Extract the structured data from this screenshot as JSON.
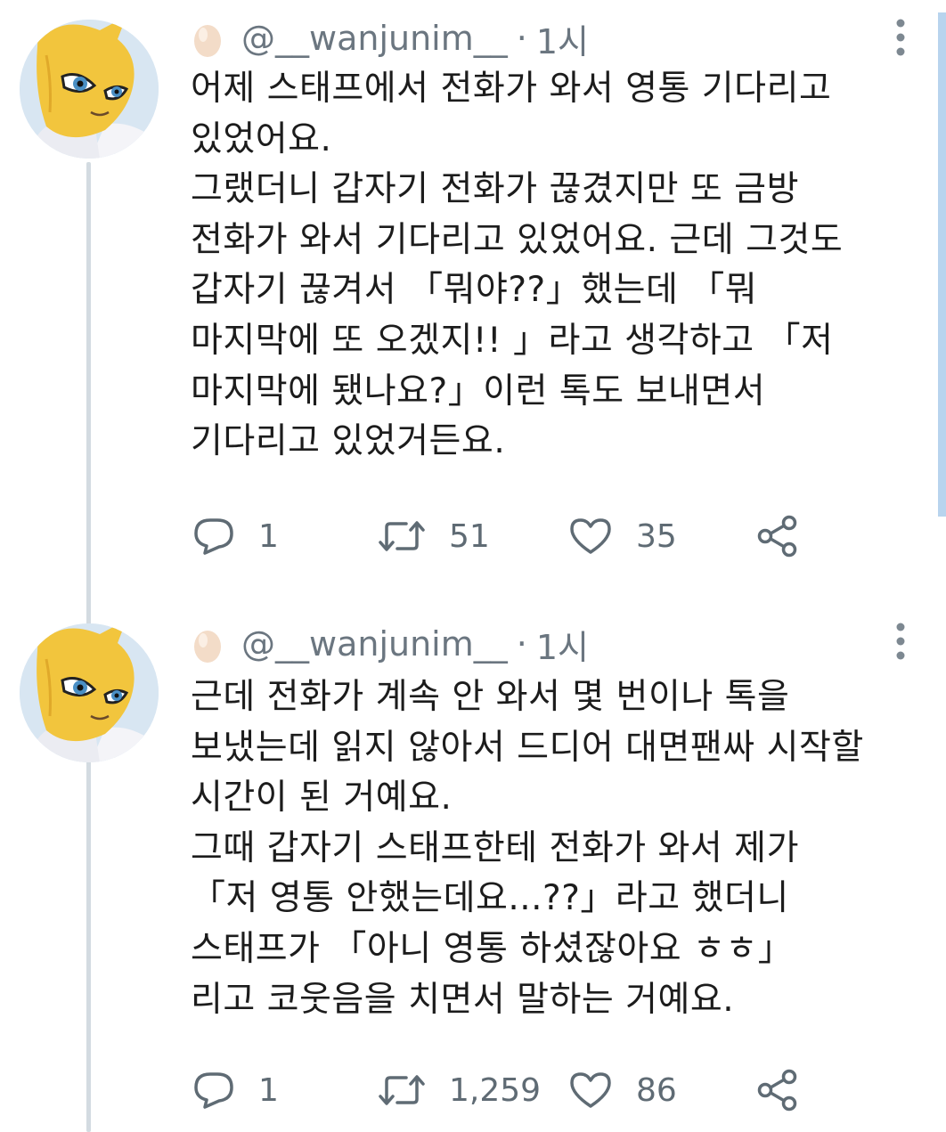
{
  "tweets": [
    {
      "handle": "@__wanjunim__",
      "separator": "·",
      "time": "1시",
      "lines": [
        "어제 스태프에서 전화가 와서 영통 기다리고",
        "있었어요.",
        "그랬더니 갑자기 전화가 끊겼지만 또 금방",
        "전화가 와서 기다리고 있었어요. 근데 그것도",
        "갑자기 끊겨서 「뭐야??」했는데 「뭐",
        "마지막에 또 오겠지!! 」라고 생각하고 「저",
        "마지막에 됐나요?」이런 톡도 보내면서",
        "기다리고 있었거든요."
      ],
      "replies": "1",
      "retweets": "51",
      "likes": "35"
    },
    {
      "handle": "@__wanjunim__",
      "separator": "·",
      "time": "1시",
      "lines": [
        "근데 전화가 계속 안 와서 몇 번이나  톡을",
        "보냈는데 읽지 않아서 드디어 대면팬싸 시작할",
        "시간이 된 거예요.",
        "그때 갑자기 스태프한테 전화가 와서 제가",
        "「저 영통 안했는데요...??」라고 했더니",
        "스태프가 「아니 영통 하셨잖아요 ㅎㅎ」",
        "리고 코웃음을 치면서 말하는 거예요."
      ],
      "replies": "1",
      "retweets": "1,259",
      "likes": "86"
    }
  ],
  "icons": {
    "avatar": "yellow-fox-avatar-icon",
    "verified_egg": "egg-icon",
    "more": "vertical-ellipsis-icon",
    "reply": "speech-bubble-icon",
    "retweet": "retweet-arrows-icon",
    "like": "heart-icon",
    "share": "share-nodes-icon"
  },
  "colors": {
    "text": "#1c1c1c",
    "muted": "#6b7680",
    "thread_line": "#d3dbe1",
    "scrollbar": "#b8d4ee",
    "avatar_yellow": "#f2c53d"
  }
}
